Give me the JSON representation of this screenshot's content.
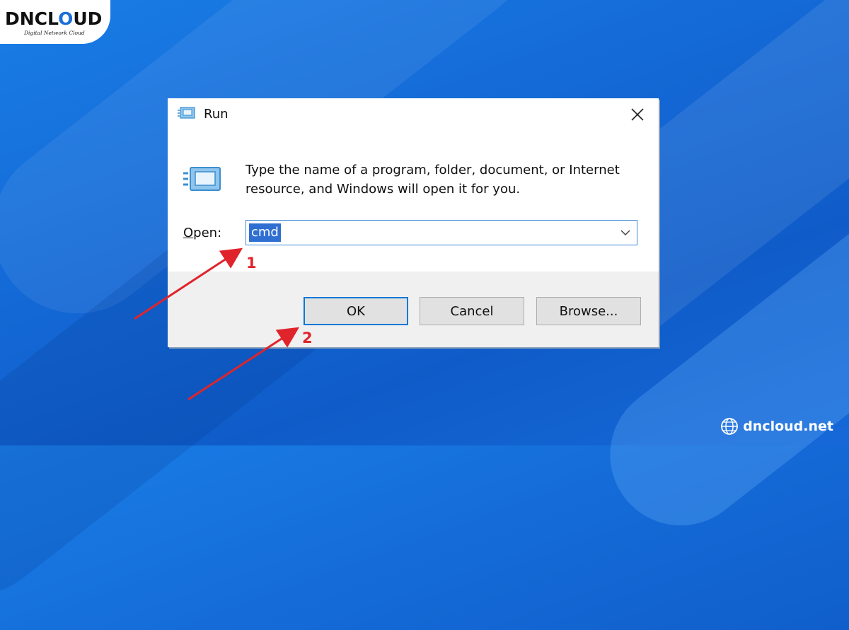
{
  "brand": {
    "logo_prefix": "DNCL",
    "logo_o": "O",
    "logo_suffix": "UD",
    "tagline": "Digital Network Cloud",
    "website": "dncloud.net"
  },
  "dialog": {
    "title": "Run",
    "description": "Type the name of a program, folder, document, or Internet resource, and Windows will open it for you.",
    "open_label_prefix": "O",
    "open_label_rest": "pen:",
    "input_value": "cmd",
    "buttons": {
      "ok": "OK",
      "cancel": "Cancel",
      "browse": "Browse..."
    },
    "icons": {
      "title": "run-icon",
      "large": "run-icon",
      "close": "close-icon",
      "dropdown": "chevron-down-icon"
    }
  },
  "annotations": {
    "step1": "1",
    "step2": "2",
    "color": "#e0242b"
  },
  "colors": {
    "background": "#1469d6",
    "selection": "#2f6fd2",
    "ok_border": "#0078d7"
  }
}
